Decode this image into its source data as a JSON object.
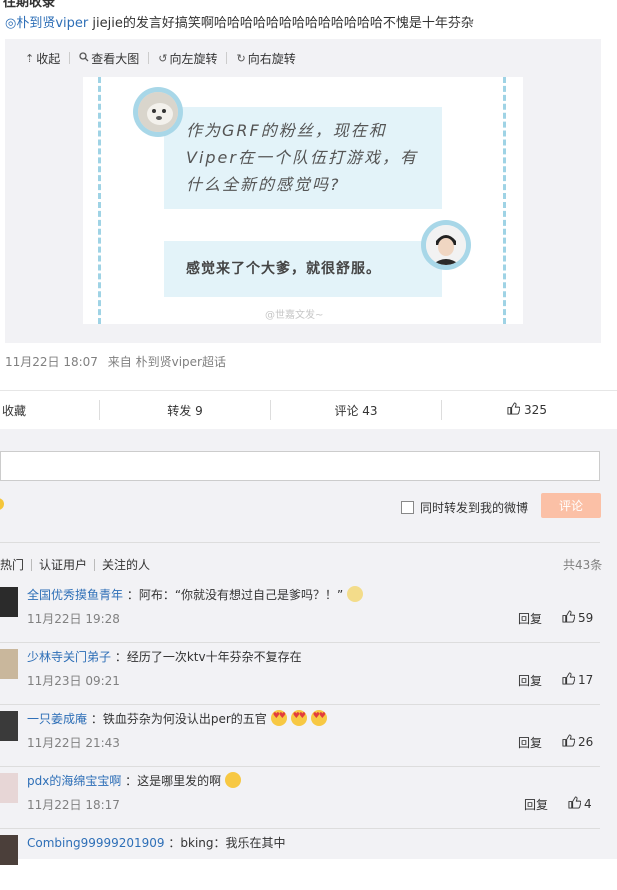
{
  "post": {
    "top_cut_text": "往期收录",
    "mention": "◎朴到贤viper",
    "text": " jiejie的发言好搞笑啊哈哈哈哈哈哈哈哈哈哈哈哈哈不愧是十年芬杂"
  },
  "media_toolbar": {
    "collapse": "收起",
    "view_large": "查看大图",
    "rotate_left": "向左旋转",
    "rotate_right": "向右旋转"
  },
  "image_card": {
    "question": "作为GRF的粉丝，现在和Viper在一个队伍打游戏，有什么全新的感觉吗?",
    "question_line1": "作为GRF的粉丝，现在和",
    "question_line2": "Viper在一个队伍打游戏，有",
    "question_line3": "什么全新的感觉吗?",
    "answer": "感觉来了个大爹，就很舒服。",
    "watermark": "@世嘉文发~"
  },
  "meta": {
    "time": "11月22日 18:07",
    "source_prefix": "来自",
    "source": "朴到贤viper超话"
  },
  "actions": {
    "favorite": "收藏",
    "repost": "转发 9",
    "comment": "评论 43",
    "like": "325"
  },
  "comment_box": {
    "repost_checkbox": "同时转发到我的微博",
    "submit": "评论"
  },
  "filters": {
    "hot": "热门",
    "verified": "认证用户",
    "following": "关注的人",
    "total": "共43条"
  },
  "comments": [
    {
      "user": "全国优秀摸鱼青年",
      "text": "：阿布：“你就没有想过自己是爹吗？！”",
      "time": "11月22日 19:28",
      "reply": "回复",
      "likes": "59",
      "emoji": "dog"
    },
    {
      "user": "少林寺关门弟子",
      "text": "：经历了一次ktv十年芬杂不复存在",
      "time": "11月23日 09:21",
      "reply": "回复",
      "likes": "17",
      "emoji": ""
    },
    {
      "user": "一只姜成庵",
      "text": "：铁血芬杂为何没认出per的五官",
      "time": "11月22日 21:43",
      "reply": "回复",
      "likes": "26",
      "emoji": "love3"
    },
    {
      "user": "pdx的海绵宝宝啊",
      "text": "：这是哪里发的啊",
      "time": "11月22日 18:17",
      "reply": "回复",
      "likes": "4",
      "emoji": "laugh"
    },
    {
      "user": "Combing99999201909",
      "text": "：bking：我乐在其中",
      "time": "",
      "reply": "",
      "likes": "",
      "emoji": ""
    }
  ],
  "colors": {
    "link_blue": "#2e6fb7",
    "submit_disabled": "#fbc0a6",
    "bubble": "#e3f3f9",
    "avatar_ring": "#a8d7e8"
  }
}
